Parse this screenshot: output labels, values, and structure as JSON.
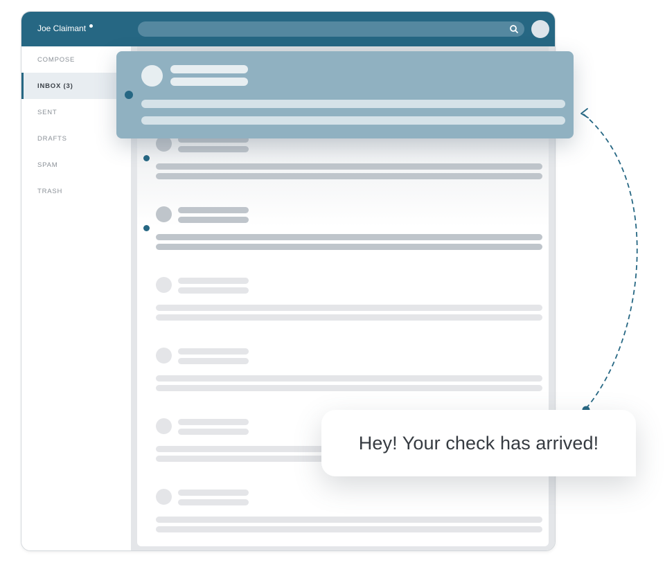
{
  "header": {
    "user_name": "Joe Claimant",
    "status": "online",
    "search_placeholder": "",
    "search_icon": "search-icon",
    "avatar_icon": "avatar"
  },
  "sidebar": {
    "items": [
      {
        "label": "COMPOSE",
        "active": false
      },
      {
        "label": "INBOX (3)",
        "active": true
      },
      {
        "label": "SENT",
        "active": false
      },
      {
        "label": "DRAFTS",
        "active": false
      },
      {
        "label": "SPAM",
        "active": false
      },
      {
        "label": "TRASH",
        "active": false
      }
    ]
  },
  "inbox": {
    "unread_count": 3,
    "messages": [
      {
        "unread": true,
        "highlighted": true
      },
      {
        "unread": true,
        "highlighted": false
      },
      {
        "unread": true,
        "highlighted": false
      },
      {
        "unread": false,
        "highlighted": false
      },
      {
        "unread": false,
        "highlighted": false
      },
      {
        "unread": false,
        "highlighted": false
      },
      {
        "unread": false,
        "highlighted": false
      }
    ]
  },
  "notification": {
    "text": "Hey! Your check has arrived!"
  },
  "colors": {
    "brand": "#266783",
    "highlight_card": "#90b1c1",
    "placeholder_unread": "#bfc5cb",
    "placeholder_read": "#e4e5e8",
    "text_dark": "#363b41"
  }
}
